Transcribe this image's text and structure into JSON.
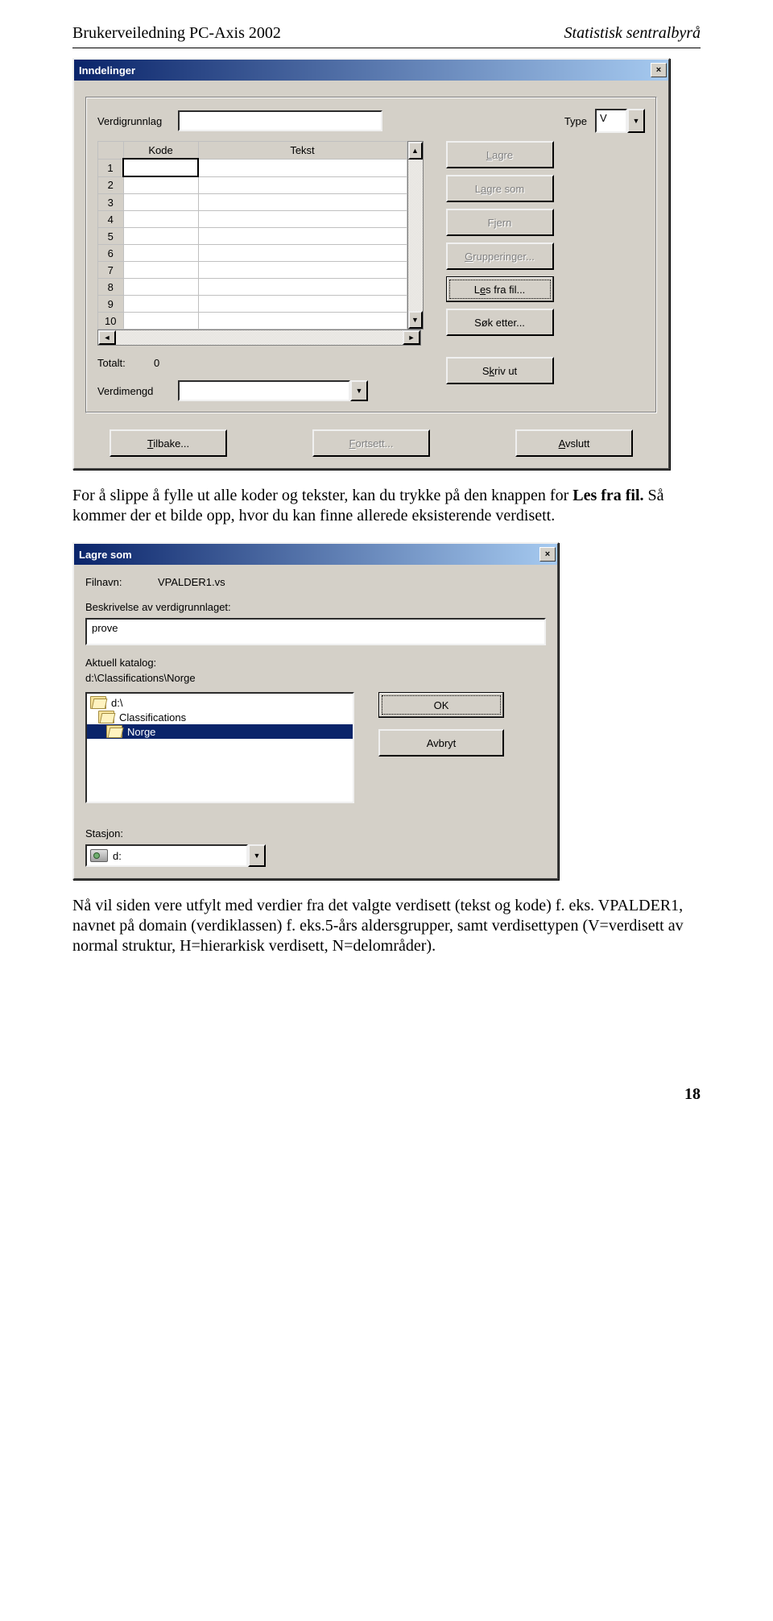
{
  "doc": {
    "header_left": "Brukerveiledning PC-Axis 2002",
    "header_right": "Statistisk sentralbyrå",
    "page_number": "18"
  },
  "dialog1": {
    "title": "Inndelinger",
    "close_label": "×",
    "verdigrunnlag_label": "Verdigrunnlag",
    "verdigrunnlag_value": "",
    "type_label": "Type",
    "type_value": "V",
    "columns": {
      "kode": "Kode",
      "tekst": "Tekst"
    },
    "rows": [
      "1",
      "2",
      "3",
      "4",
      "5",
      "6",
      "7",
      "8",
      "9",
      "10"
    ],
    "totalt_label": "Totalt:",
    "totalt_value": "0",
    "verdimengd_label": "Verdimengd",
    "verdimengd_value": "",
    "buttons": {
      "lagre": "Lagre",
      "lagre_som": "Lagre som",
      "fjern": "Fjern",
      "grupperinger": "Grupperinger...",
      "les_fra_fil": "Les fra fil...",
      "sok_etter": "Søk etter...",
      "skriv_ut": "Skriv ut"
    },
    "bottom": {
      "tilbake": "Tilbake...",
      "fortsett": "Fortsett...",
      "avslutt": "Avslutt"
    }
  },
  "para1": "For å slippe å fylle ut alle koder og tekster, kan du trykke på den knappen for Les fra fil. Så kommer der et bilde opp, hvor du kan finne allerede eksisterende verdisett.",
  "dialog2": {
    "title": "Lagre som",
    "close_label": "×",
    "filnavn_label": "Filnavn:",
    "filnavn_value": "VPALDER1.vs",
    "beskrivelse_label": "Beskrivelse av verdigrunnlaget:",
    "beskrivelse_value": "prove",
    "aktuell_label": "Aktuell katalog:",
    "aktuell_value": "d:\\Classifications\\Norge",
    "folders": [
      "d:\\",
      "Classifications",
      "Norge"
    ],
    "ok_label": "OK",
    "avbryt_label": "Avbryt",
    "stasjon_label": "Stasjon:",
    "stasjon_value": "d:"
  },
  "para2": "Nå vil siden vere utfylt med verdier fra det valgte verdisett (tekst og kode) f. eks. VPALDER1, navnet på domain (verdiklassen) f. eks.5-års aldersgrupper, samt verdisettypen (V=verdisett av normal struktur, H=hierarkisk verdisett, N=delområder)."
}
